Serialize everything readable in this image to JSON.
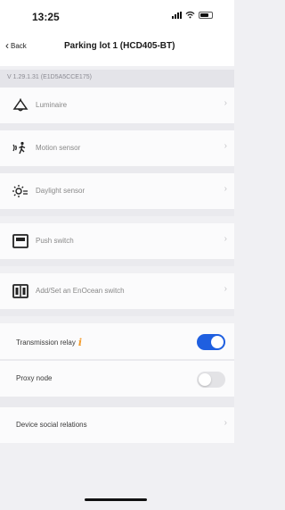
{
  "status_bar": {
    "time": "13:25"
  },
  "nav": {
    "back_label": "Back",
    "title": "Parking lot 1 (HCD405-BT)"
  },
  "version": "V 1.29.1.31 (E1D5A5CCE175)",
  "rows": [
    {
      "label": "Luminaire",
      "icon": "lamp-icon"
    },
    {
      "label": "Motion sensor",
      "icon": "motion-sensor-icon"
    },
    {
      "label": "Daylight sensor",
      "icon": "daylight-sensor-icon"
    },
    {
      "label": "Push switch",
      "icon": "push-switch-icon"
    },
    {
      "label": "Add/Set an EnOcean switch",
      "icon": "enocean-switch-icon"
    }
  ],
  "settings": {
    "transmission_relay": {
      "label": "Transmission relay",
      "on": true
    },
    "proxy_node": {
      "label": "Proxy node",
      "on": false
    },
    "device_social_relations": {
      "label": "Device social relations"
    }
  },
  "colors": {
    "accent": "#1f5fe0",
    "info": "#f39b2a"
  }
}
